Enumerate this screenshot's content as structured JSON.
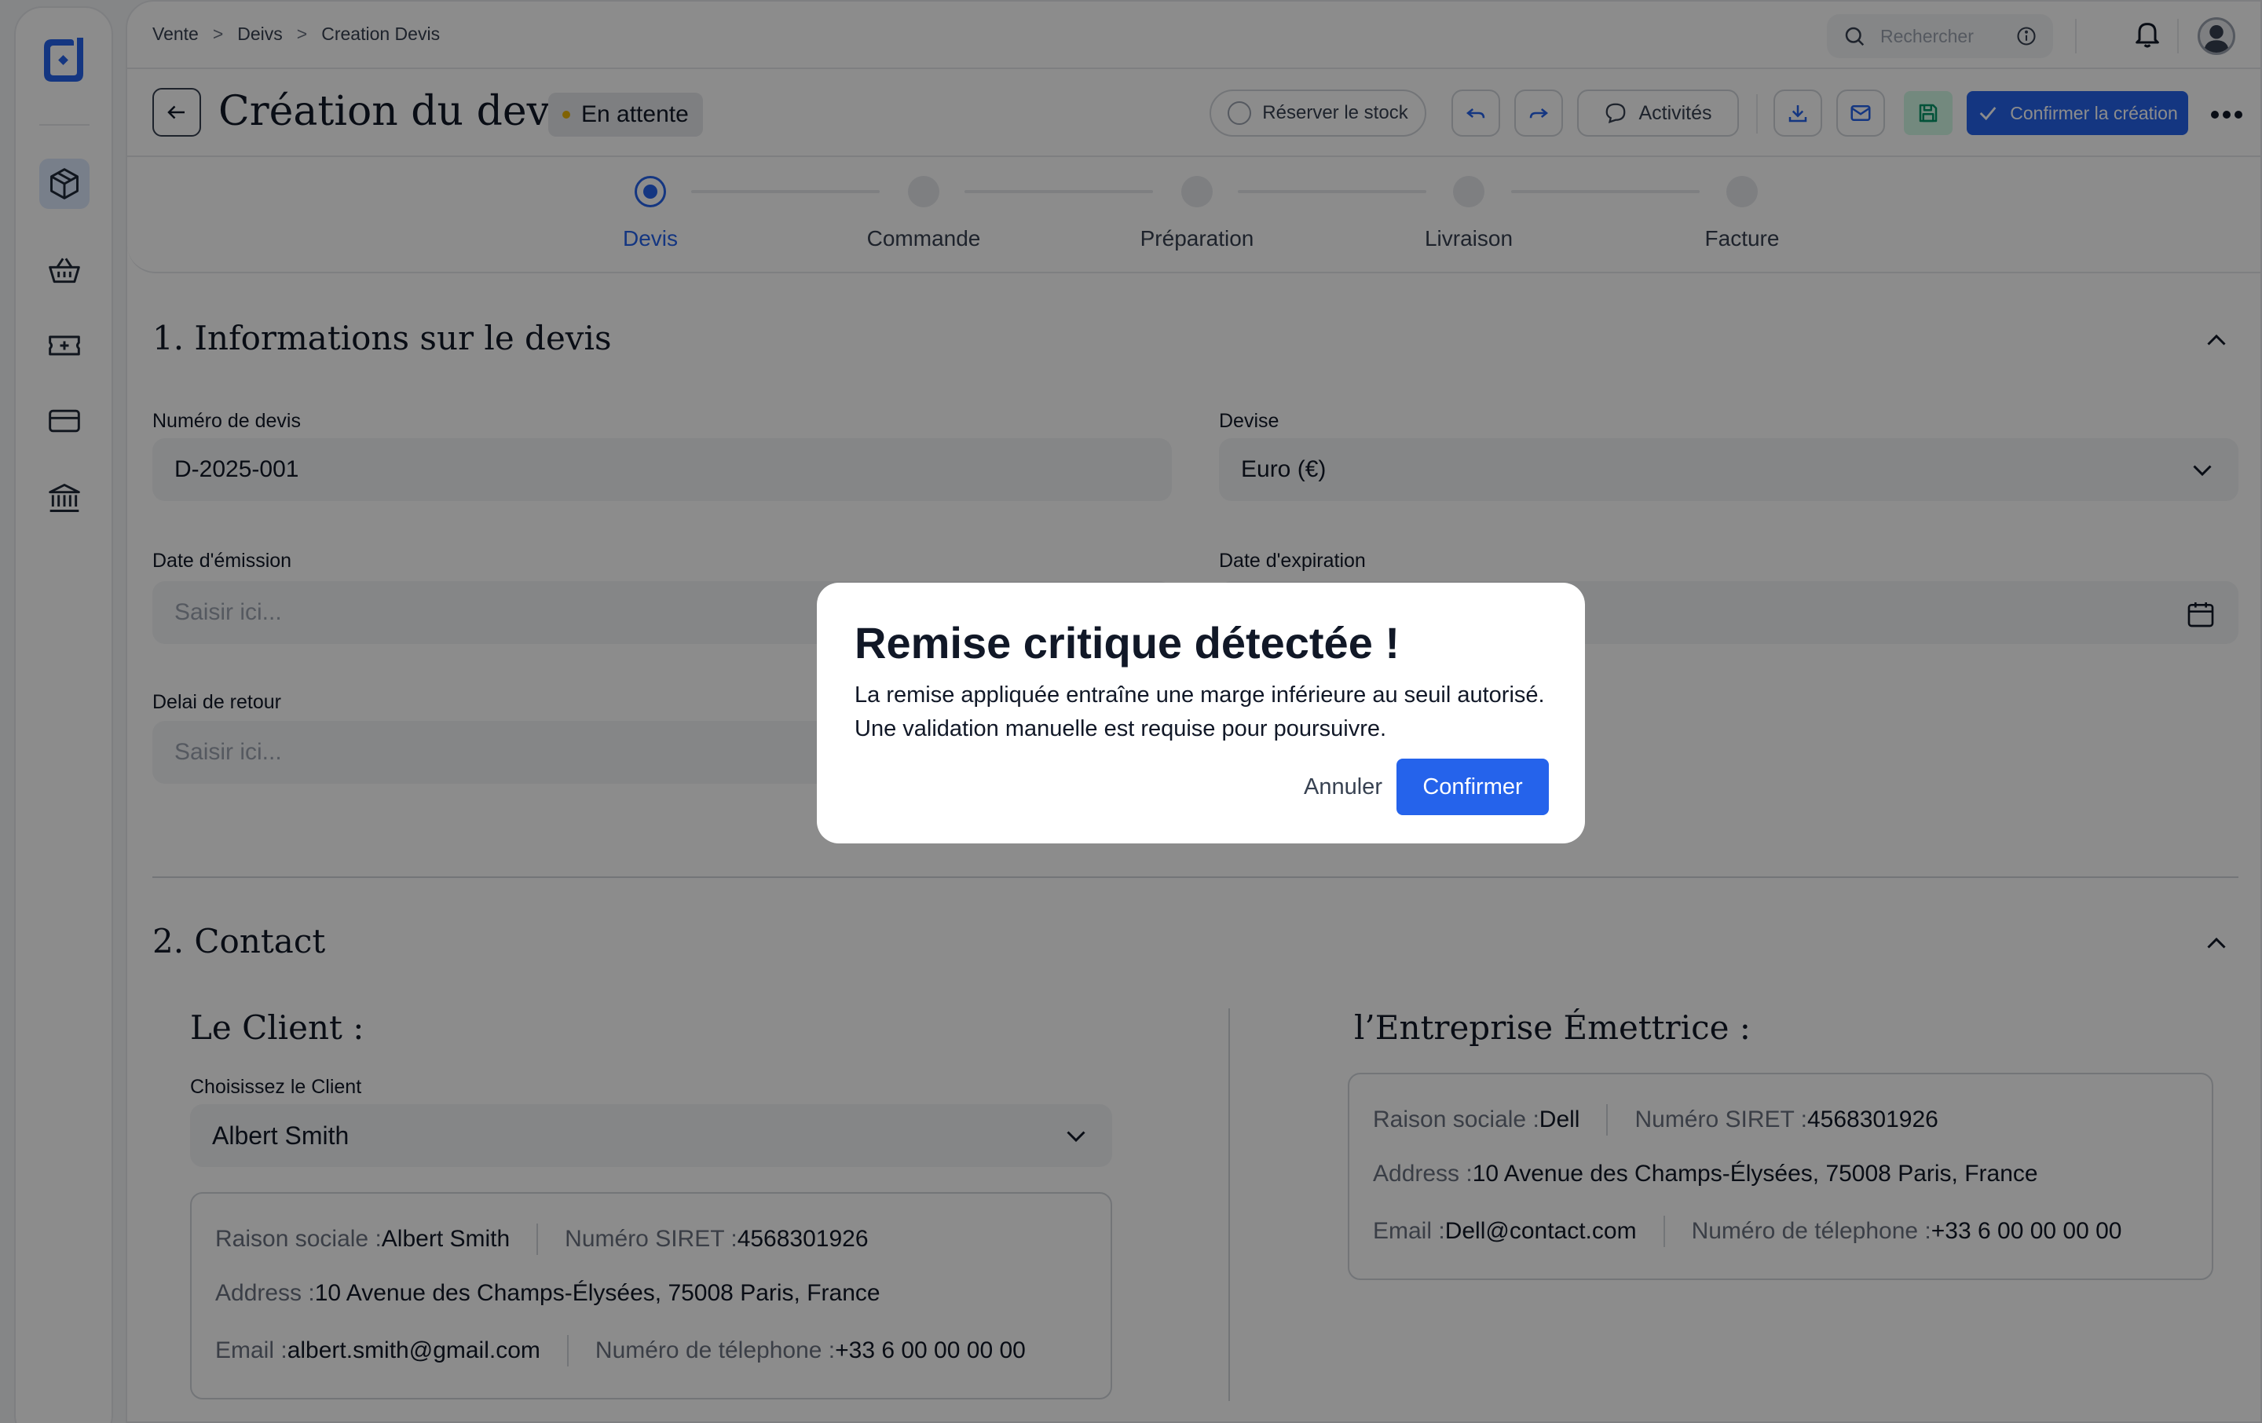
{
  "colors": {
    "accent": "#2563eb",
    "status_pending": "#eab308",
    "save_bg": "#d1fae5"
  },
  "breadcrumb": [
    "Vente",
    "Deivs",
    "Creation Devis"
  ],
  "breadcrumb_sep": ">",
  "search": {
    "placeholder": "Rechercher"
  },
  "header": {
    "title": "Création du devis",
    "status": "En attente",
    "reserve_stock": "Réserver le stock",
    "activities": "Activités",
    "confirm_create": "Confirmer la création"
  },
  "sidebar": {
    "items": [
      {
        "icon": "box-icon",
        "active": true
      },
      {
        "icon": "basket-icon",
        "active": false
      },
      {
        "icon": "ticket-icon",
        "active": false
      },
      {
        "icon": "card-icon",
        "active": false
      },
      {
        "icon": "bank-icon",
        "active": false
      }
    ]
  },
  "stepper": {
    "steps": [
      {
        "label": "Devis",
        "active": true
      },
      {
        "label": "Commande",
        "active": false
      },
      {
        "label": "Préparation",
        "active": false
      },
      {
        "label": "Livraison",
        "active": false
      },
      {
        "label": "Facture",
        "active": false
      }
    ]
  },
  "section1": {
    "title": "1. Informations sur le devis",
    "quote_number": {
      "label": "Numéro de devis",
      "value": "D-2025-001"
    },
    "currency": {
      "label": "Devise",
      "value": "Euro (€)"
    },
    "issue_date": {
      "label": "Date d'émission",
      "placeholder": "Saisir ici..."
    },
    "expiry_date": {
      "label": "Date d'expiration"
    },
    "return_delay": {
      "label": "Delai de retour",
      "placeholder": "Saisir ici..."
    }
  },
  "section2": {
    "title": "2. Contact",
    "client": {
      "title": "Le Client :",
      "select_label": "Choisissez le Client",
      "selected": "Albert Smith",
      "raison_k": "Raison sociale : ",
      "raison_v": "Albert Smith",
      "siret_k": "Numéro SIRET : ",
      "siret_v": "4568301926",
      "address_k": "Address : ",
      "address_v": "10 Avenue des Champs-Élysées, 75008 Paris, France",
      "email_k": "Email : ",
      "email_v": "albert.smith@gmail.com",
      "phone_k": "Numéro de télephone : ",
      "phone_v": "+33 6 00 00 00 00"
    },
    "company": {
      "title": "l’Entreprise Émettrice :",
      "raison_k": "Raison sociale : ",
      "raison_v": "Dell",
      "siret_k": "Numéro SIRET : ",
      "siret_v": "4568301926",
      "address_k": "Address : ",
      "address_v": "10 Avenue des Champs-Élysées, 75008 Paris, France",
      "email_k": "Email : ",
      "email_v": "Dell@contact.com",
      "phone_k": "Numéro de télephone : ",
      "phone_v": "+33 6 00 00 00 00"
    }
  },
  "modal": {
    "title": "Remise critique détectée !",
    "line1": "La remise appliquée entraîne une marge inférieure au seuil autorisé.",
    "line2": "Une validation manuelle est requise pour poursuivre.",
    "cancel": "Annuler",
    "confirm": "Confirmer"
  }
}
